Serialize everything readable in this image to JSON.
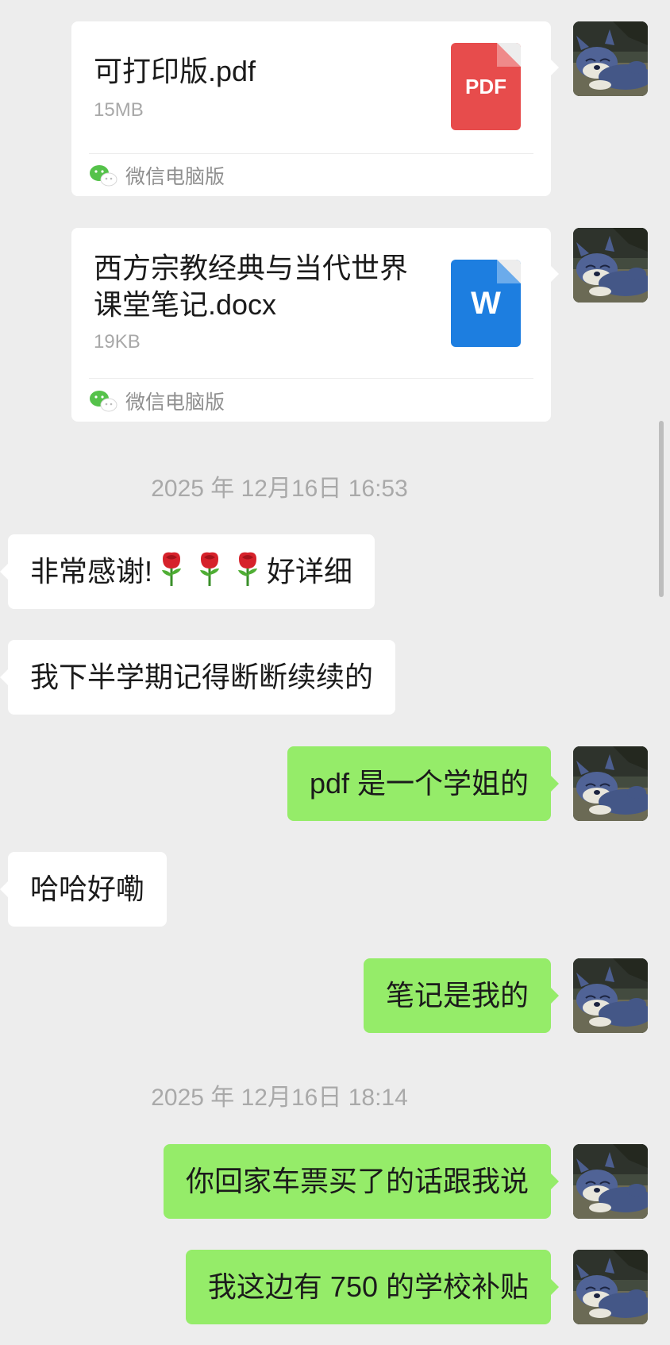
{
  "files": [
    {
      "name": "可打印版.pdf",
      "size": "15MB",
      "icon_label": "PDF",
      "icon_color": "#e74c4c",
      "source": "微信电脑版"
    },
    {
      "name": "西方宗教经典与当代世界课堂笔记.docx",
      "size": "19KB",
      "icon_label": "W",
      "icon_color": "#1d7ee0",
      "source": "微信电脑版"
    }
  ],
  "timestamps": [
    "2025 年 12月16日 16:53",
    "2025 年 12月16日 18:14"
  ],
  "messages": {
    "m1_before": "非常感谢!",
    "m1_after": "好详细",
    "m2": "我下半学期记得断断续续的",
    "m3": "pdf 是一个学姐的",
    "m4": "哈哈好嘞",
    "m5": "笔记是我的",
    "m6": "你回家车票买了的话跟我说",
    "m7": "我这边有 750 的学校补贴"
  },
  "colors": {
    "incoming_bubble": "#ffffff",
    "outgoing_bubble": "#95ec69",
    "background": "#ededed"
  },
  "icons": [
    "rose-emoji",
    "wechat-icon",
    "pdf-file-icon",
    "word-file-icon",
    "tom-cat-avatar"
  ]
}
